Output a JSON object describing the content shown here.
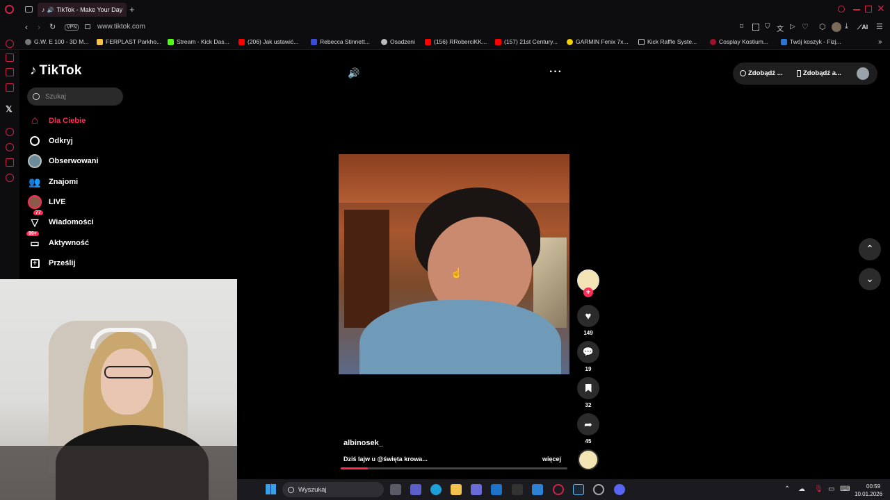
{
  "browser": {
    "tab_title": "TikTok - Make Your Day",
    "new_tab": "+",
    "url": "www.tiktok.com",
    "vpn": "VPN",
    "ai_label": "AI",
    "bookmarks": [
      "G.W. E 100 - 3D M...",
      "FERPLAST Parkho...",
      "Stream - Kick Das...",
      "(206) Jak ustawić...",
      "Rebecca Stinnett...",
      "Osadzeni",
      "(156) RRoberciKK...",
      "(157) 21st Century...",
      "GARMIN Fenix 7x...",
      "Kick Raffle Syste...",
      "Cosplay Kostium...",
      "Twój koszyk - Fizj..."
    ]
  },
  "tiktok": {
    "logo": "TikTok",
    "search_placeholder": "Szukaj",
    "nav": [
      {
        "label": "Dla Ciebie",
        "icon": "home-icon",
        "active": true
      },
      {
        "label": "Odkryj",
        "icon": "compass-icon"
      },
      {
        "label": "Obserwowani",
        "icon": "avatar-icon"
      },
      {
        "label": "Znajomi",
        "icon": "friends-icon"
      },
      {
        "label": "LIVE",
        "icon": "live-avatar-icon"
      },
      {
        "label": "Wiadomości",
        "icon": "messages-icon",
        "badge": "77"
      },
      {
        "label": "Aktywność",
        "icon": "activity-icon",
        "badge": "99+"
      },
      {
        "label": "Prześlij",
        "icon": "upload-icon"
      }
    ],
    "top_buttons": [
      "Zdobądź ...",
      "Zdobądź a..."
    ],
    "video": {
      "author": "albinosek_",
      "caption": "Dziś lajw u @święta krowa...",
      "more": "więcej",
      "progress": 0.12
    },
    "actions": {
      "likes": "149",
      "comments": "19",
      "saves": "32",
      "shares": "45"
    }
  },
  "taskbar": {
    "search": "Wyszukaj",
    "time": "00:59",
    "date": "10.01.2026"
  },
  "colors": {
    "accent": "#fe2c55",
    "opera": "#d0234a"
  }
}
